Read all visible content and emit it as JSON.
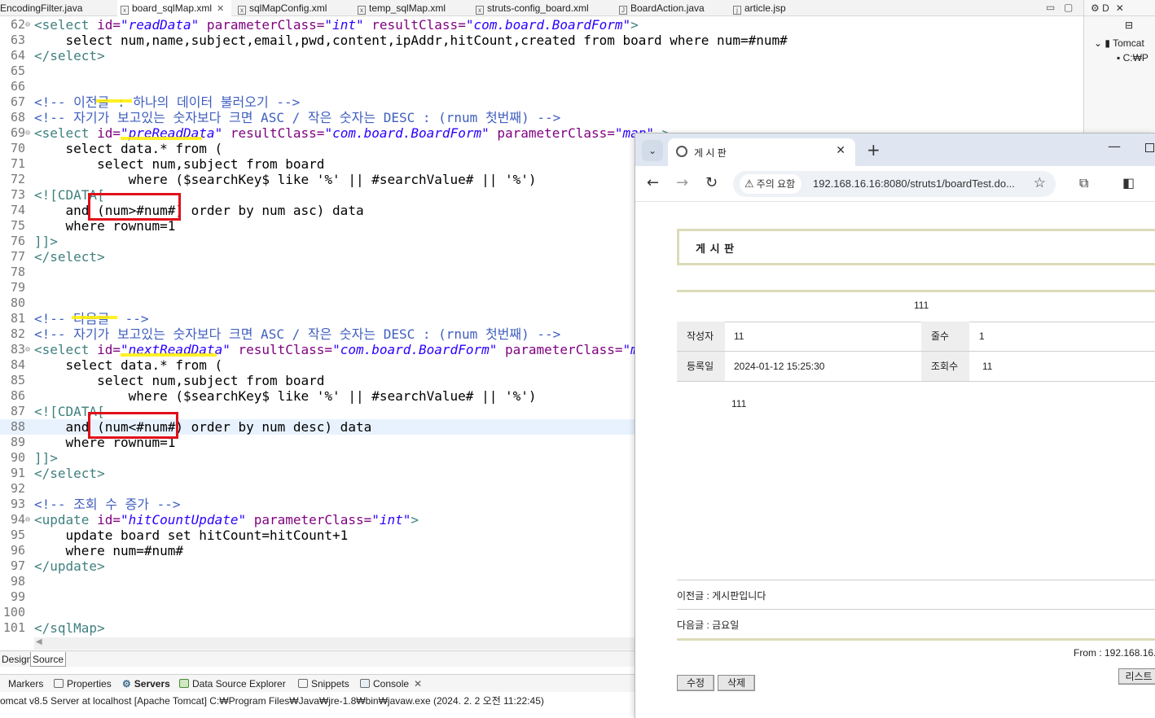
{
  "ide": {
    "tabs": [
      {
        "label": "EncodingFilter.java"
      },
      {
        "label": "board_sqlMap.xml",
        "close": "✕"
      },
      {
        "label": "sqlMapConfig.xml"
      },
      {
        "label": "temp_sqlMap.xml"
      },
      {
        "label": "struts-config_board.xml"
      },
      {
        "label": "BoardAction.java"
      },
      {
        "label": "article.jsp"
      }
    ],
    "right_panel": {
      "tab": "D",
      "server_label": "Tomcat",
      "path": "C:₩P"
    },
    "code_lines": [
      {
        "n": "62",
        "parts": [
          [
            "t-tag",
            "<select "
          ],
          [
            "t-attr",
            "id="
          ],
          [
            "t-val",
            "\"readData\""
          ],
          [
            "t-attr",
            " parameterClass="
          ],
          [
            "t-val",
            "\"int\""
          ],
          [
            "t-attr",
            " resultClass="
          ],
          [
            "t-val",
            "\"com.board.BoardForm\""
          ],
          [
            "t-tag",
            ">"
          ]
        ]
      },
      {
        "n": "63",
        "parts": [
          [
            "t-sql",
            "    select num,name,subject,email,pwd,content,ipAddr,hitCount,created from board where num=#num#"
          ]
        ]
      },
      {
        "n": "64",
        "parts": [
          [
            "t-tag",
            "</select>"
          ]
        ]
      },
      {
        "n": "65",
        "parts": []
      },
      {
        "n": "66",
        "parts": []
      },
      {
        "n": "67",
        "parts": [
          [
            "t-cmt",
            "<!-- 이전글 : 하나의 데이터 불러오기 -->"
          ]
        ]
      },
      {
        "n": "68",
        "parts": [
          [
            "t-cmt",
            "<!-- 자기가 보고있는 숫자보다 크면 ASC / 작은 숫자는 DESC : (rnum 첫번째) -->"
          ]
        ]
      },
      {
        "n": "69",
        "parts": [
          [
            "t-tag",
            "<select "
          ],
          [
            "t-attr",
            "id="
          ],
          [
            "t-val",
            "\"preReadData\""
          ],
          [
            "t-attr",
            " resultClass="
          ],
          [
            "t-val",
            "\"com.board.BoardForm\""
          ],
          [
            "t-attr",
            " parameterClass="
          ],
          [
            "t-val",
            "\"map\""
          ],
          [
            "t-tag",
            " >"
          ]
        ]
      },
      {
        "n": "70",
        "parts": [
          [
            "t-sql",
            "    select data.* from ("
          ]
        ]
      },
      {
        "n": "71",
        "parts": [
          [
            "t-sql",
            "        select num,subject from board"
          ]
        ]
      },
      {
        "n": "72",
        "parts": [
          [
            "t-sql",
            "            where ($searchKey$ like '%' || #searchValue# || '%')"
          ]
        ]
      },
      {
        "n": "73",
        "parts": [
          [
            "t-tag",
            "<![CDATA["
          ]
        ]
      },
      {
        "n": "74",
        "parts": [
          [
            "t-sql",
            "    and (num>#num#) order by num asc) data"
          ]
        ]
      },
      {
        "n": "75",
        "parts": [
          [
            "t-sql",
            "    where rownum=1"
          ]
        ]
      },
      {
        "n": "76",
        "parts": [
          [
            "t-tag",
            "]]>"
          ]
        ]
      },
      {
        "n": "77",
        "parts": [
          [
            "t-tag",
            "</select>"
          ]
        ]
      },
      {
        "n": "78",
        "parts": []
      },
      {
        "n": "79",
        "parts": []
      },
      {
        "n": "80",
        "parts": []
      },
      {
        "n": "81",
        "parts": [
          [
            "t-cmt",
            "<!-- 다음글  -->"
          ]
        ]
      },
      {
        "n": "82",
        "parts": [
          [
            "t-cmt",
            "<!-- 자기가 보고있는 숫자보다 크면 ASC / 작은 숫자는 DESC : (rnum 첫번째) -->"
          ]
        ]
      },
      {
        "n": "83",
        "parts": [
          [
            "t-tag",
            "<select "
          ],
          [
            "t-attr",
            "id="
          ],
          [
            "t-val",
            "\"nextReadData\""
          ],
          [
            "t-attr",
            " resultClass="
          ],
          [
            "t-val",
            "\"com.board.BoardForm\""
          ],
          [
            "t-attr",
            " parameterClass="
          ],
          [
            "t-val",
            "\"map\""
          ],
          [
            "t-tag",
            " >"
          ]
        ]
      },
      {
        "n": "84",
        "parts": [
          [
            "t-sql",
            "    select data.* from ("
          ]
        ]
      },
      {
        "n": "85",
        "parts": [
          [
            "t-sql",
            "        select num,subject from board"
          ]
        ]
      },
      {
        "n": "86",
        "parts": [
          [
            "t-sql",
            "            where ($searchKey$ like '%' || #searchValue# || '%')"
          ]
        ]
      },
      {
        "n": "87",
        "parts": [
          [
            "t-tag",
            "<![CDATA["
          ]
        ]
      },
      {
        "n": "88",
        "parts": [
          [
            "t-sql",
            "    and (num<#num#) order by num desc) data"
          ]
        ]
      },
      {
        "n": "89",
        "parts": [
          [
            "t-sql",
            "    where rownum=1"
          ]
        ]
      },
      {
        "n": "90",
        "parts": [
          [
            "t-tag",
            "]]>"
          ]
        ]
      },
      {
        "n": "91",
        "parts": [
          [
            "t-tag",
            "</select>"
          ]
        ]
      },
      {
        "n": "92",
        "parts": []
      },
      {
        "n": "93",
        "parts": [
          [
            "t-cmt",
            "<!-- 조회 수 증가 -->"
          ]
        ]
      },
      {
        "n": "94",
        "parts": [
          [
            "t-tag",
            "<update "
          ],
          [
            "t-attr",
            "id="
          ],
          [
            "t-val",
            "\"hitCountUpdate\""
          ],
          [
            "t-attr",
            " parameterClass="
          ],
          [
            "t-val",
            "\"int\""
          ],
          [
            "t-tag",
            ">"
          ]
        ]
      },
      {
        "n": "95",
        "parts": [
          [
            "t-sql",
            "    update board set hitCount=hitCount+1"
          ]
        ]
      },
      {
        "n": "96",
        "parts": [
          [
            "t-sql",
            "    where num=#num#"
          ]
        ]
      },
      {
        "n": "97",
        "parts": [
          [
            "t-tag",
            "</update>"
          ]
        ]
      },
      {
        "n": "98",
        "parts": []
      },
      {
        "n": "99",
        "parts": []
      },
      {
        "n": "100",
        "parts": []
      },
      {
        "n": "101",
        "parts": [
          [
            "t-tag",
            "</sqlMap>"
          ]
        ]
      }
    ],
    "editor_tabs": {
      "design": "Design",
      "source": "Source"
    },
    "views": {
      "markers": "Markers",
      "properties": "Properties",
      "servers": "Servers",
      "data_source": "Data Source Explorer",
      "snippets": "Snippets",
      "console": "Console",
      "console_close": "✕"
    },
    "console_status": "omcat v8.5 Server at localhost [Apache Tomcat] C:₩Program Files₩Java₩jre-1.8₩bin₩javaw.exe  (2024. 2. 2 오전 11:22:45)"
  },
  "browser": {
    "tab_title": "게 시 판",
    "tab_close": "✕",
    "new_tab": "+",
    "security_chip": "주의 요함",
    "url": "192.168.16.16:8080/struts1/boardTest.do...",
    "page": {
      "board_title": "게 시 판",
      "subject": "111",
      "author_label": "작성자",
      "author": "11",
      "lines_label": "줄수",
      "lines": "1",
      "created_label": "등록일",
      "created": "2024-01-12 15:25:30",
      "hits_label": "조회수",
      "hits": "11",
      "content": "111",
      "prev": "이전글 : 게시판입니다",
      "next": "다음글 : 금요일",
      "from": "From : 192.168.16.",
      "edit_button": "수정",
      "delete_button": "삭제",
      "list_button": "리스트"
    }
  }
}
